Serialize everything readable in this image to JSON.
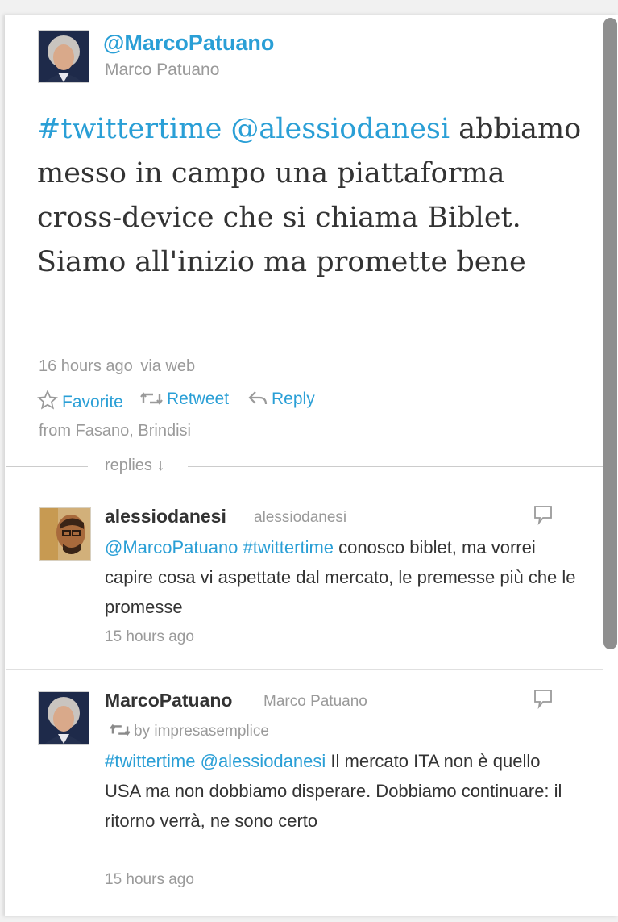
{
  "tweet": {
    "handle": "@MarcoPatuano",
    "name": "Marco Patuano",
    "text_parts": {
      "hashtag": "#twittertime",
      "mention": "@alessiodanesi",
      "body": "abbiamo messo in campo una piattaforma cross-device che si chiama Biblet. Siamo all'inizio ma promette bene"
    },
    "time": "16 hours ago",
    "source": "via web",
    "place": "from Fasano, Brindisi",
    "actions": {
      "favorite": "Favorite",
      "retweet": "Retweet",
      "reply": "Reply"
    }
  },
  "replies_label": "replies ↓",
  "replies": [
    {
      "name": "alessiodanesi",
      "handle": "alessiodanesi",
      "mention": "@MarcoPatuano",
      "hashtag": "#twittertime",
      "text": "conosco biblet, ma vorrei capire cosa vi aspettate dal mercato, le premesse più che le promesse",
      "time": "15 hours ago"
    },
    {
      "name": "MarcoPatuano",
      "handle": "Marco Patuano",
      "retweeted_by": "by impresasemplice",
      "hashtag": "#twittertime",
      "mention": "@alessiodanesi",
      "text": "Il mercato ITA non è quello USA ma non dobbiamo disperare. Dobbiamo continuare: il ritorno verrà, ne sono certo",
      "time": "15 hours ago"
    }
  ],
  "colors": {
    "link": "#2a9fd6",
    "text": "#333333",
    "muted": "#9a9a9a"
  }
}
